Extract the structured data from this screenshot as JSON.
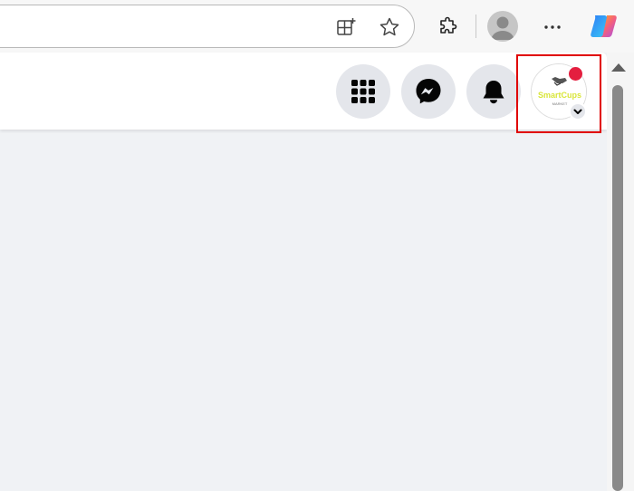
{
  "browser": {
    "address_value": "",
    "icons": [
      "split-screen-icon",
      "favorite-star-icon",
      "extensions-icon",
      "browser-profile-icon",
      "more-options-icon",
      "copilot-icon"
    ]
  },
  "header": {
    "buttons": [
      "menu-grid-icon",
      "messenger-icon",
      "notifications-bell-icon",
      "account-profile-picture"
    ],
    "profile": {
      "logo_text": "SmartCups",
      "logo_subtext": "MARKET"
    }
  },
  "colors": {
    "page_background": "#f0f2f5",
    "header_background": "#ffffff",
    "button_background": "#e4e6eb",
    "notification_dot": "#e41e3f",
    "highlight_box": "#e00000"
  }
}
